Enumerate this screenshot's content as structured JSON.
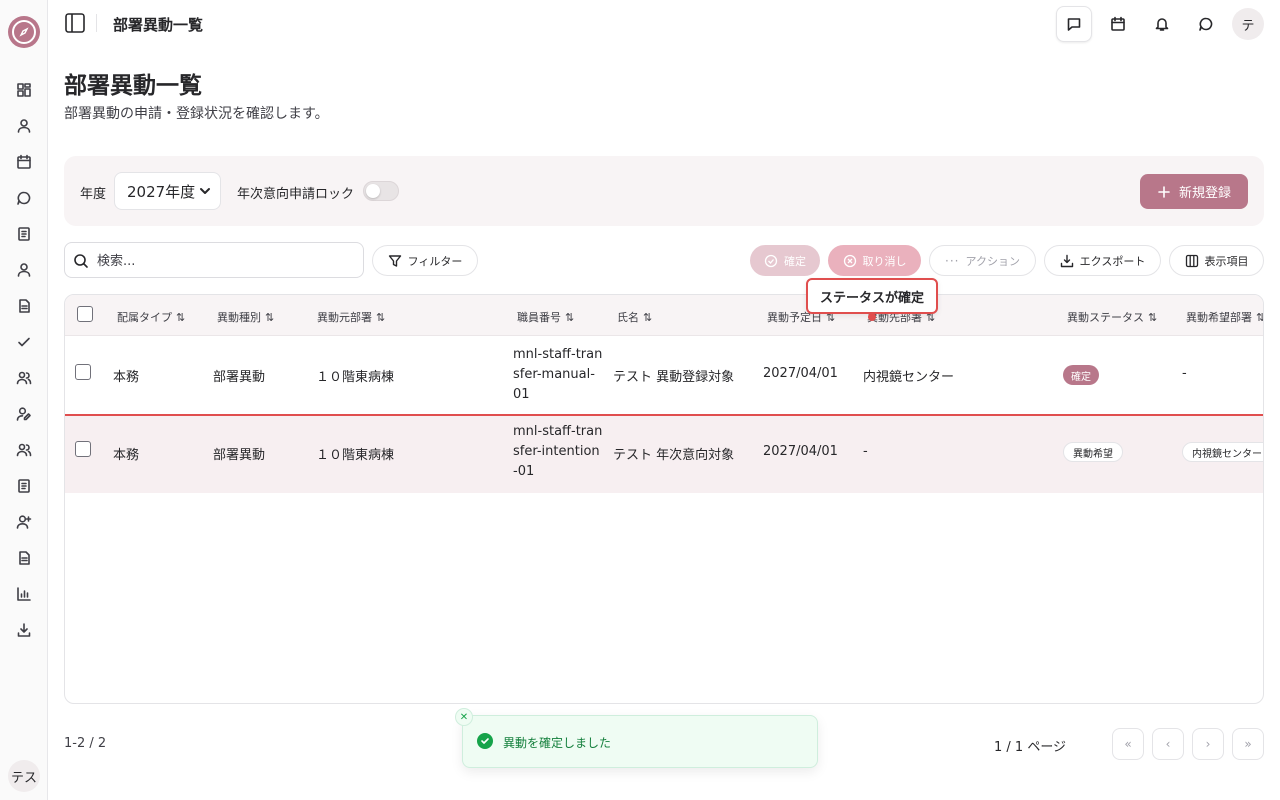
{
  "header": {
    "title": "部署異動一覧",
    "avatar": "テ"
  },
  "sidebar": {
    "avatar": "テス"
  },
  "page": {
    "title": "部署異動一覧",
    "subtitle": "部署異動の申請・登録状況を確認します。"
  },
  "filters": {
    "fiscal_year_label": "年度",
    "fiscal_year_value": "2027年度",
    "lock_label": "年次意向申請ロック",
    "lock_enabled": false,
    "new_button": "新規登録"
  },
  "toolbar": {
    "search_placeholder": "検索...",
    "filter": "フィルター",
    "confirm": "確定",
    "cancel": "取り消し",
    "action": "アクション",
    "export": "エクスポート",
    "columns": "表示項目"
  },
  "table": {
    "columns": [
      "配属タイプ",
      "異動種別",
      "異動元部署",
      "職員番号",
      "氏名",
      "異動予定日",
      "異動先部署",
      "異動ステータス",
      "異動希望部署"
    ],
    "rows": [
      {
        "type": "本務",
        "kind": "部署異動",
        "from": "１０階東病棟",
        "staff_no": "mnl-staff-transfer-manual-01",
        "name": "テスト 異動登録対象",
        "date": "2027/04/01",
        "to": "内視鏡センター",
        "status": "確定",
        "wish": "-"
      },
      {
        "type": "本務",
        "kind": "部署異動",
        "from": "１０階東病棟",
        "staff_no": "mnl-staff-transfer-intention-01",
        "name": "テスト 年次意向対象",
        "date": "2027/04/01",
        "to": "-",
        "status": "異動希望",
        "wish": "内視鏡センター"
      }
    ]
  },
  "tooltip": "ステータスが確定",
  "pagination": {
    "count": "1-2 / 2",
    "pages": "1 / 1 ページ"
  },
  "toast": {
    "message": "異動を確定しました"
  },
  "colors": {
    "accent": "#b8778a",
    "success": "#16a34a",
    "highlight": "#e04e4e"
  }
}
